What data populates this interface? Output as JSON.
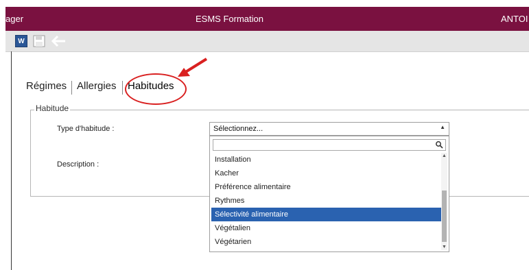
{
  "header": {
    "left_text": "ager",
    "app_title": "ESMS Formation",
    "user": "ANTOI"
  },
  "toolbar": {
    "word_label": "W",
    "icons": [
      "word-export-icon",
      "save-icon",
      "back-arrow-icon"
    ]
  },
  "tabs": [
    {
      "label": "Régimes"
    },
    {
      "label": "Allergies"
    },
    {
      "label": "Habitudes",
      "active": true
    }
  ],
  "form": {
    "legend": "Habitude",
    "type_label": "Type d'habitude :",
    "description_label": "Description :",
    "select": {
      "value": "Sélectionnez...",
      "search_value": "",
      "options": [
        "Installation",
        "Kacher",
        "Préférence alimentaire",
        "Rythmes",
        "Sélectivité alimentaire",
        "Végétalien",
        "Végétarien"
      ],
      "selected_option": "Sélectivité alimentaire"
    }
  },
  "colors": {
    "header_bg": "#7a1140",
    "selected_bg": "#2a62b0",
    "annotation": "#d92020"
  }
}
